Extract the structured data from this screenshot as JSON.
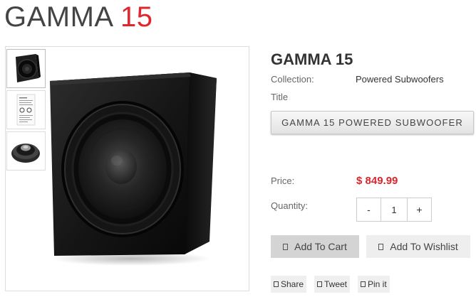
{
  "page_title": {
    "main": "GAMMA",
    "number": "15"
  },
  "product": {
    "title": "GAMMA 15",
    "collection_label": "Collection:",
    "collection_value": "Powered Subwoofers",
    "variant_label": "Title",
    "variant_option": "GAMMA 15 POWERED SUBWOOFER",
    "price_label": "Price:",
    "price": "$ 849.99",
    "quantity_label": "Quantity:",
    "quantity": "1",
    "decrement": "-",
    "increment": "+"
  },
  "actions": {
    "add_to_cart": "Add To Cart",
    "add_to_wishlist": "Add To Wishlist"
  },
  "social": {
    "share": "Share",
    "tweet": "Tweet",
    "pin": "Pin it"
  },
  "gallery": {
    "thumbnails": [
      "subwoofer-front",
      "spec-sheet",
      "driver-cone"
    ]
  },
  "colors": {
    "accent_red": "#e0262c",
    "price_red": "#d9262c",
    "cart_button_bg": "#d4d4d4",
    "wishlist_button_bg": "#eeeeee"
  }
}
